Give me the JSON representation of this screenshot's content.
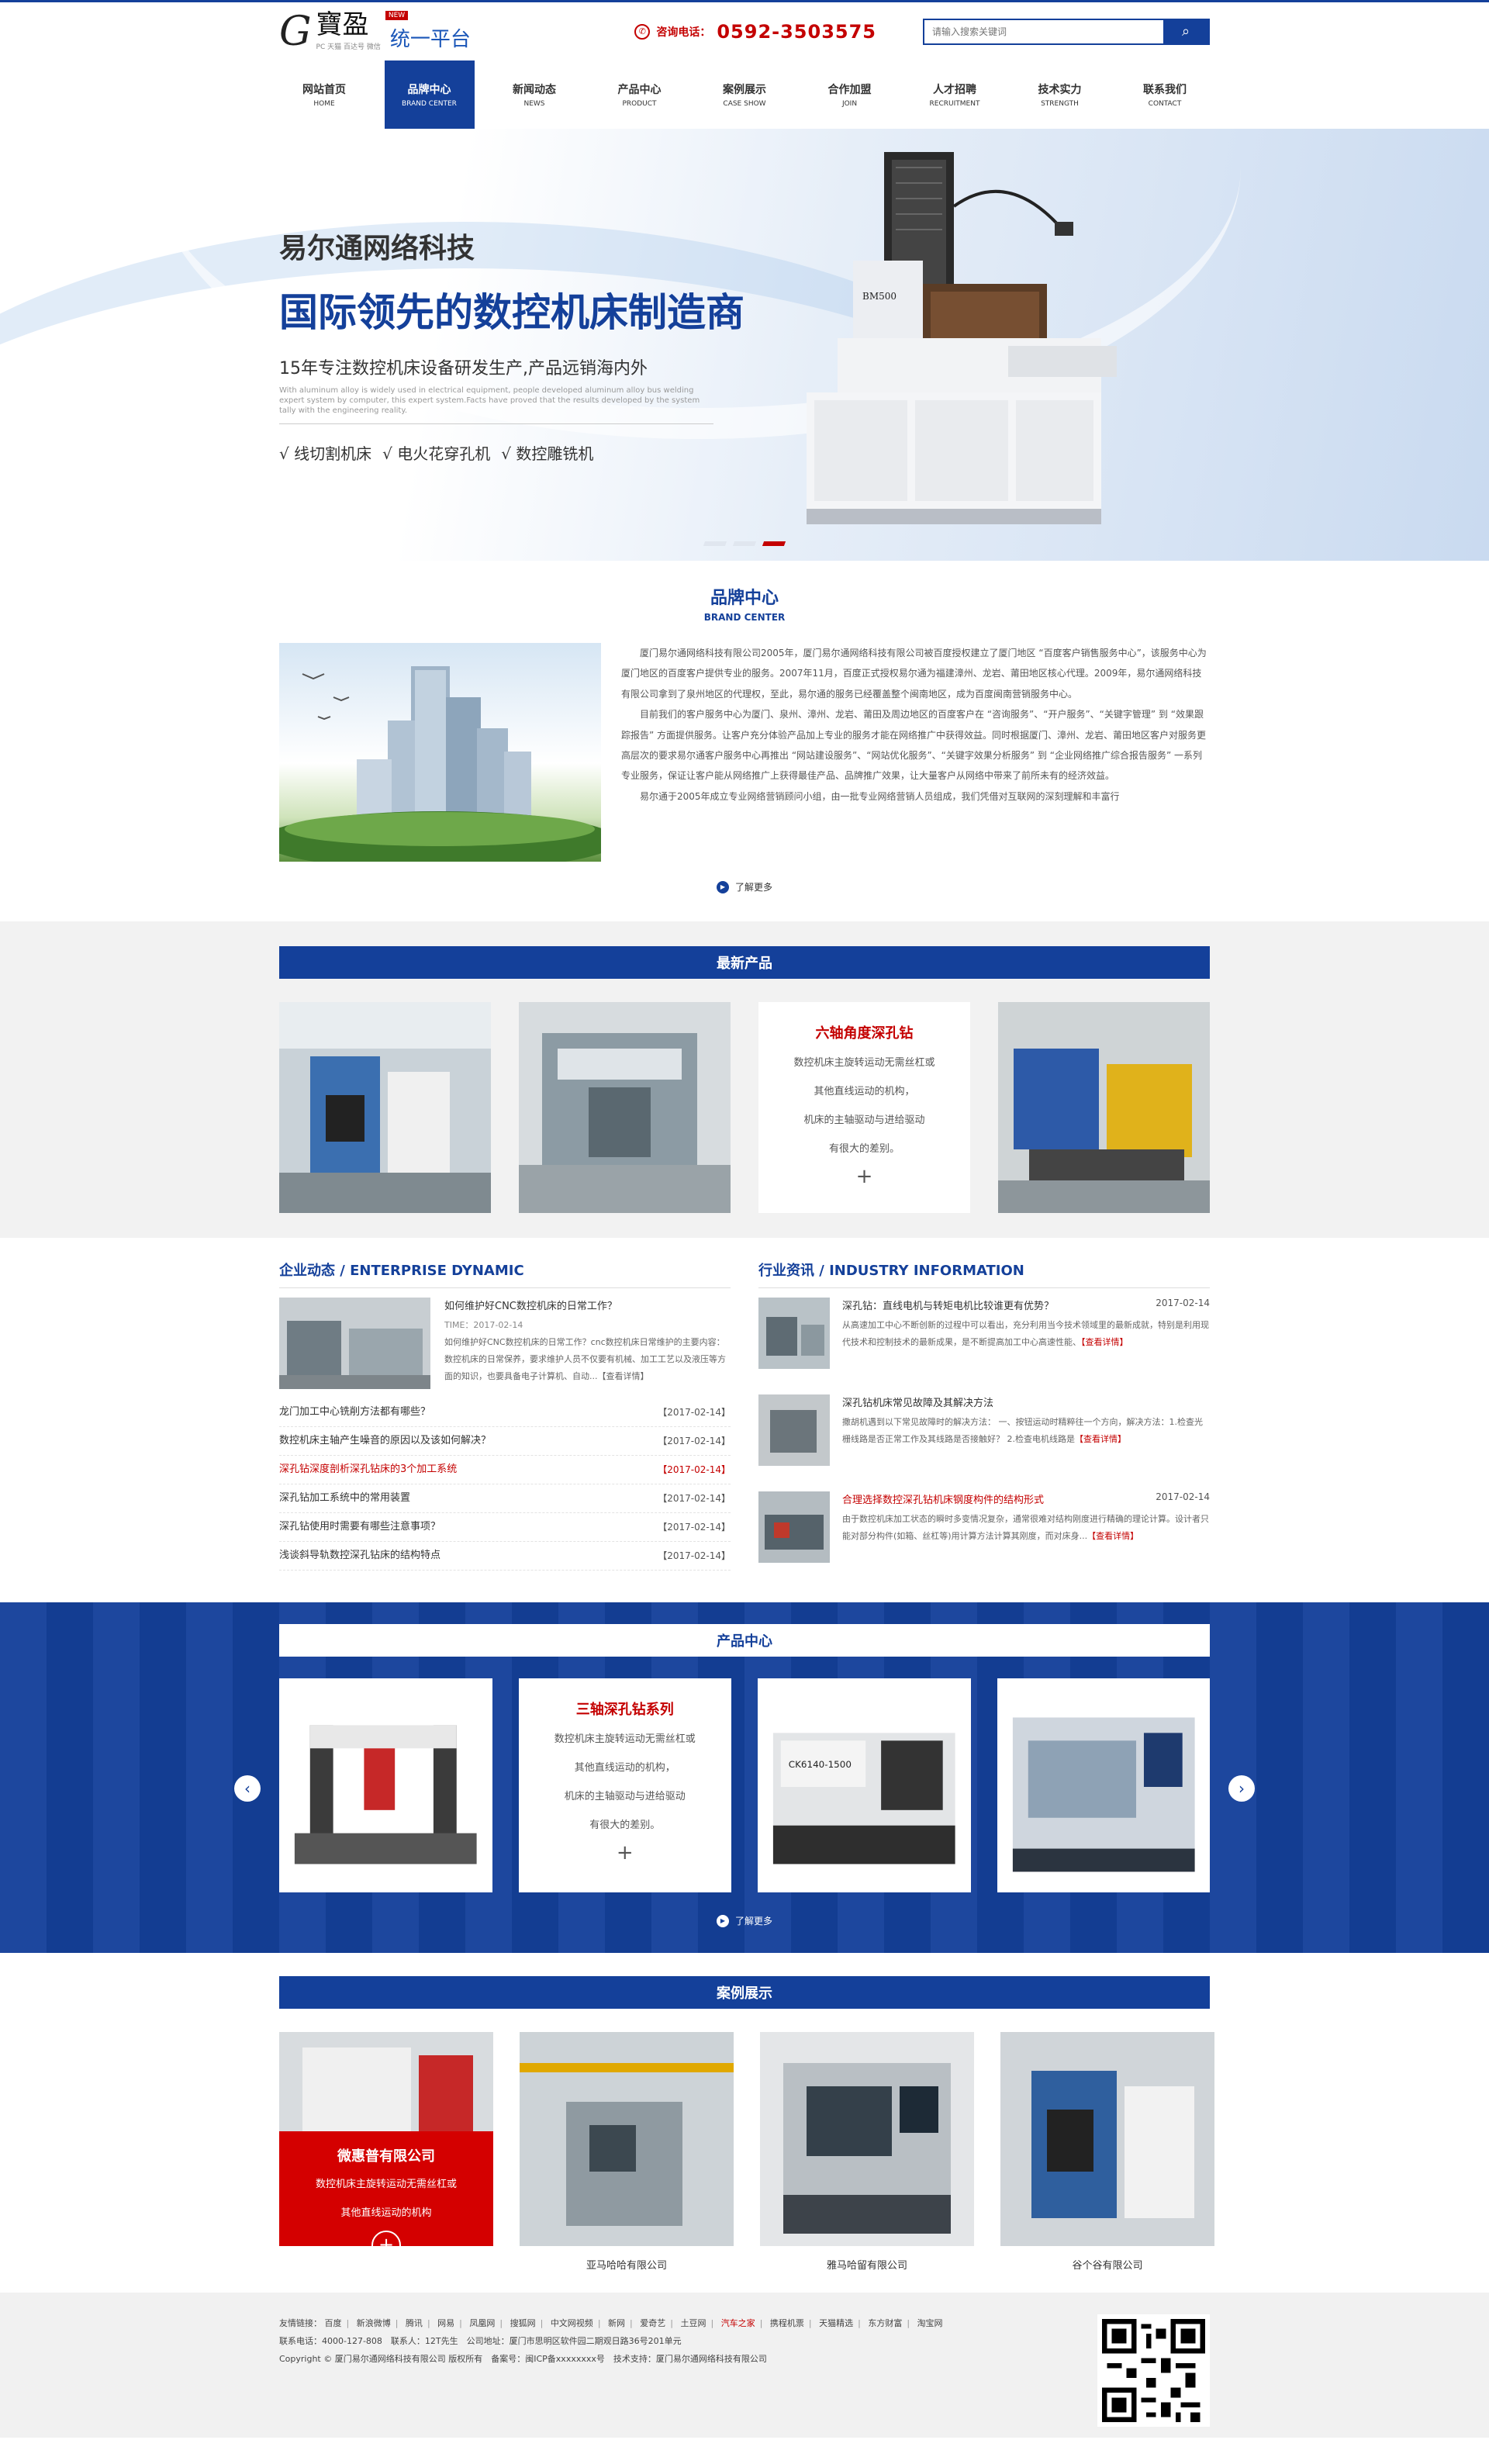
{
  "logo": {
    "main": "寶盈",
    "new": "NEW",
    "platform": "统一平台",
    "sub": "PC 天猫 百达号 微信"
  },
  "hotline": {
    "label": "咨询电话：",
    "number": "0592-3503575",
    "icon": "phone-icon"
  },
  "search": {
    "placeholder": "请输入搜索关键词",
    "button_icon": "search-icon"
  },
  "nav": [
    {
      "cn": "网站首页",
      "en": "HOME"
    },
    {
      "cn": "品牌中心",
      "en": "BRAND CENTER"
    },
    {
      "cn": "新闻动态",
      "en": "NEWS"
    },
    {
      "cn": "产品中心",
      "en": "PRODUCT"
    },
    {
      "cn": "案例展示",
      "en": "CASE SHOW"
    },
    {
      "cn": "合作加盟",
      "en": "JOIN"
    },
    {
      "cn": "人才招聘",
      "en": "RECRUITMENT"
    },
    {
      "cn": "技术实力",
      "en": "STRENGTH"
    },
    {
      "cn": "联系我们",
      "en": "CONTACT"
    }
  ],
  "banner": {
    "company": "易尔通网络科技",
    "title": "国际领先的数控机床制造商",
    "subtitle": "15年专注数控机床设备研发生产,产品远销海内外",
    "en_text": "With aluminum alloy is widely used in electrical equipment, people developed aluminum alloy bus welding expert system by computer, this expert system.Facts have proved that the results developed by the system tally with the engineering reality.",
    "tags": [
      "√ 线切割机床",
      "√ 电火花穿孔机",
      "√ 数控雕铣机"
    ],
    "machine_label": "BM500"
  },
  "brand": {
    "title": "品牌中心",
    "title_en": "BRAND CENTER",
    "paragraphs": [
      "厦门易尔通网络科技有限公司2005年，厦门易尔通网络科技有限公司被百度授权建立了厦门地区 “百度客户销售服务中心”，该服务中心为厦门地区的百度客户提供专业的服务。2007年11月，百度正式授权易尔通为福建漳州、龙岩、莆田地区核心代理。2009年，易尔通网络科技有限公司拿到了泉州地区的代理权，至此，易尔通的服务已经覆盖整个闽南地区，成为百度闽南营销服务中心。",
      "目前我们的客户服务中心为厦门、泉州、漳州、龙岩、莆田及周边地区的百度客户在 “咨询服务”、“开户服务”、“关键字管理” 到 “效果跟踪报告” 方面提供服务。让客户充分体验产品加上专业的服务才能在网络推广中获得效益。同时根据厦门、漳州、龙岩、莆田地区客户对服务更高层次的要求易尔通客户服务中心再推出 “网站建设服务”、“网站优化服务”、“关键字效果分析服务” 到 “企业网络推广综合报告服务” 一系列专业服务，保证让客户能从网络推广上获得最佳产品、品牌推广效果，让大量客户从网络中带来了前所未有的经济效益。",
      "易尔通于2005年成立专业网络营销顾问小组，由一批专业网络营销人员组成，我们凭借对互联网的深刻理解和丰富行"
    ],
    "more": "了解更多"
  },
  "new_products": {
    "title": "最新产品",
    "featured": {
      "title": "六轴角度深孔钻",
      "lines": [
        "数控机床主旋转运动无需丝杠或",
        "其他直线运动的机构，",
        "机床的主轴驱动与进给驱动",
        "有很大的差别。"
      ]
    }
  },
  "enterprise": {
    "title": "企业动态 / ENTERPRISE DYNAMIC",
    "featured": {
      "title": "如何维护好CNC数控机床的日常工作？",
      "time": "TIME：2017-02-14",
      "desc": "如何维护好CNC数控机床的日常工作？cnc数控机床日常维护的主要内容：数控机床的日常保养，要求维护人员不仅要有机械、加工工艺以及液压等方面的知识，也要具备电子计算机、自动...【查看详情】"
    },
    "items": [
      {
        "title": "龙门加工中心铣削方法都有哪些？",
        "date": "【2017-02-14】",
        "red": false
      },
      {
        "title": "数控机床主轴产生噪音的原因以及该如何解决？",
        "date": "【2017-02-14】",
        "red": false
      },
      {
        "title": "深孔钻深度剖析深孔钻床的3个加工系统",
        "date": "【2017-02-14】",
        "red": true
      },
      {
        "title": "深孔钻加工系统中的常用装置",
        "date": "【2017-02-14】",
        "red": false
      },
      {
        "title": "深孔钻使用时需要有哪些注意事项？",
        "date": "【2017-02-14】",
        "red": false
      },
      {
        "title": "浅谈斜导轨数控深孔钻床的结构特点",
        "date": "【2017-02-14】",
        "red": false
      }
    ]
  },
  "industry": {
    "title": "行业资讯 / INDUSTRY INFORMATION",
    "items": [
      {
        "title": "深孔钻：直线电机与转矩电机比较谁更有优势？",
        "date": "2017-02-14",
        "red": false,
        "desc": "从高速加工中心不断创新的过程中可以看出，充分利用当今技术领域里的最新成就，特别是利用现代技术和控制技术的最新成果，是不断提高加工中心高速性能、",
        "link": "【查看详情】"
      },
      {
        "title": "深孔钻机床常见故障及其解决方法",
        "date": "",
        "red": false,
        "desc": "撒胡机遇到以下常见故障时的解决方法： 一、按钮运动时精粹往一个方向，解决方法：1.检查光栅线路是否正常工作及其线路是否接触好？ 2.检查电机线路是",
        "link": "【查看详情】"
      },
      {
        "title": "合理选择数控深孔钻机床钢度构件的结构形式",
        "date": "2017-02-14",
        "red": true,
        "desc": "由于数控机床加工状态的瞬时多变情况复杂，通常很难对结构刚度进行精确的理论计算。设计者只能对部分构件(如箱、丝杠等)用计算方法计算其刚度，而对床身...",
        "link": "【查看详情】"
      }
    ]
  },
  "product_center": {
    "title": "产品中心",
    "featured": {
      "title": "三轴深孔钻系列",
      "lines": [
        "数控机床主旋转运动无需丝杠或",
        "其他直线运动的机构，",
        "机床的主轴驱动与进给驱动",
        "有很大的差别。"
      ]
    },
    "lathe_label": "CK6140-1500",
    "prev_icon": "chevron-left-icon",
    "next_icon": "chevron-right-icon",
    "more": "了解更多"
  },
  "cases": {
    "title": "案例展示",
    "featured": {
      "title": "微惠普有限公司",
      "lines": [
        "数控机床主旋转运动无需丝杠或",
        "其他直线运动的机构"
      ]
    },
    "captions": [
      "",
      "亚马哈哈有限公司",
      "雅马哈留有限公司",
      "谷个谷有限公司"
    ]
  },
  "footer": {
    "links_label": "友情链接：",
    "links": [
      "百度",
      "新浪微博",
      "腾讯",
      "网易",
      "凤凰网",
      "搜狐网",
      "中文网视频",
      "新网",
      "爱奇艺",
      "土豆网",
      "汽车之家",
      "携程机票",
      "天猫精选",
      "东方财富",
      "淘宝网"
    ],
    "highlight": "汽车之家",
    "contact": "联系电话：4000-127-808　联系人：12T先生　公司地址：厦门市思明区软件园二期观日路36号201单元",
    "copyright": "Copyright © 厦门易尔通网络科技有限公司 版权所有　备案号：闽ICP备xxxxxxxx号　技术支持：厦门易尔通网络科技有限公司"
  },
  "colors": {
    "primary": "#14409a",
    "accent": "#c40000",
    "case_overlay": "#d40000"
  }
}
